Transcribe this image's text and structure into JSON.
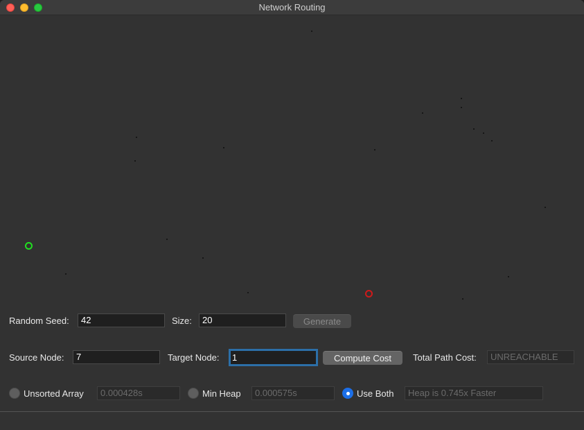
{
  "window": {
    "title": "Network Routing"
  },
  "graph": {
    "node_color": "#0d0d0d",
    "source_color": "#20e020",
    "target_color": "#d01a1a"
  },
  "generate_row": {
    "seed_label": "Random Seed:",
    "seed_value": "42",
    "size_label": "Size:",
    "size_value": "20",
    "generate_label": "Generate"
  },
  "route_row": {
    "source_label": "Source Node:",
    "source_value": "7",
    "target_label": "Target Node:",
    "target_value": "1",
    "compute_label": "Compute Cost",
    "total_label": "Total Path Cost:",
    "total_value": "UNREACHABLE"
  },
  "timing_row": {
    "unsorted_label": "Unsorted Array",
    "unsorted_time": "0.000428s",
    "heap_label": "Min Heap",
    "heap_time": "0.000575s",
    "both_label": "Use Both",
    "comparison": "Heap is 0.745x Faster",
    "selected": "Use Both",
    "accent_color": "#1c6fe8"
  }
}
